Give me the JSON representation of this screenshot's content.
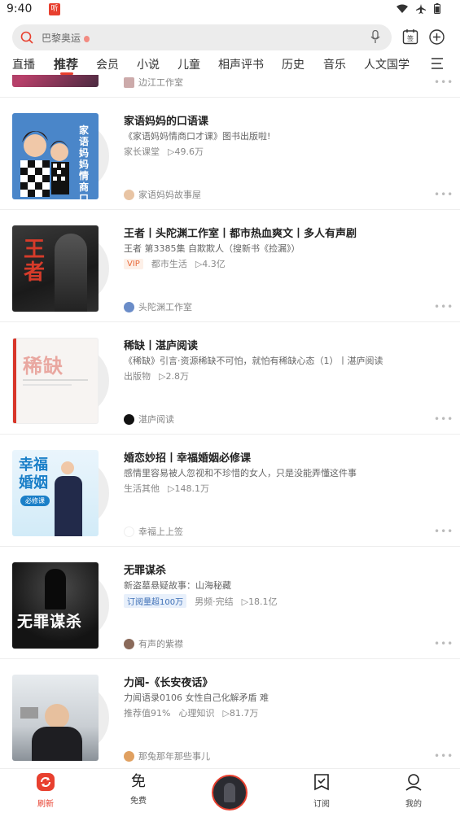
{
  "status_bar": {
    "time": "9:40",
    "app_icon_label": "听"
  },
  "search": {
    "placeholder": "巴黎奥运"
  },
  "tabs": [
    {
      "label": "直播"
    },
    {
      "label": "推荐"
    },
    {
      "label": "会员"
    },
    {
      "label": "小说"
    },
    {
      "label": "儿童"
    },
    {
      "label": "相声评书"
    },
    {
      "label": "历史"
    },
    {
      "label": "音乐"
    },
    {
      "label": "人文国学"
    }
  ],
  "active_tab": "推荐",
  "partial_item": {
    "author": "边江工作室"
  },
  "items": [
    {
      "title": "家语妈妈的口语课",
      "subtitle": "《家语妈妈情商口才课》图书出版啦!",
      "category": "家长课堂",
      "plays": "49.6万",
      "author": "家语妈妈故事屋",
      "cover_text": "家语妈妈情商口才课"
    },
    {
      "title": "王者丨头陀渊工作室丨都市热血爽文丨多人有声剧",
      "subtitle": "王者 第3385集 自欺欺人（搜新书《捡漏》）",
      "badge": "VIP",
      "category": "都市生活",
      "plays": "4.3亿",
      "author": "头陀渊工作室",
      "cover_text": "王者"
    },
    {
      "title": "稀缺丨湛庐阅读",
      "subtitle": "《稀缺》引言·资源稀缺不可怕，就怕有稀缺心态（1）丨湛庐阅读",
      "category": "出版物",
      "plays": "2.8万",
      "author": "湛庐阅读",
      "cover_text": "稀缺"
    },
    {
      "title": "婚恋妙招丨幸福婚姻必修课",
      "subtitle": "感情里容易被人忽视和不珍惜的女人，只是没能弄懂这件事",
      "category": "生活其他",
      "plays": "148.1万",
      "author": "幸福上上签",
      "cover_text": "幸福婚姻",
      "cover_sub": "必修课"
    },
    {
      "title": "无罪谋杀",
      "subtitle": "新盗墓悬疑故事：山海秘藏",
      "badge": "订阅量超100万",
      "category": "男频·完结",
      "plays": "18.1亿",
      "author": "有声的紫襟",
      "cover_text": "无罪谋杀"
    },
    {
      "title": "力闻-《长安夜话》",
      "subtitle": "力闻语录0106 女性自己化解矛盾 难",
      "category": "推荐值91%",
      "category2": "心理知识",
      "plays": "81.7万",
      "author": "那兔那年那些事儿"
    }
  ],
  "bottom_nav": [
    {
      "label": "刷新"
    },
    {
      "label": "免费"
    },
    {
      "label": ""
    },
    {
      "label": "订阅"
    },
    {
      "label": "我的"
    }
  ],
  "bottom_nav_free_glyph": "免",
  "colors": {
    "accent": "#e8402f",
    "badge_vip": "#e86a3a",
    "badge_blue": "#3d6fb6"
  }
}
